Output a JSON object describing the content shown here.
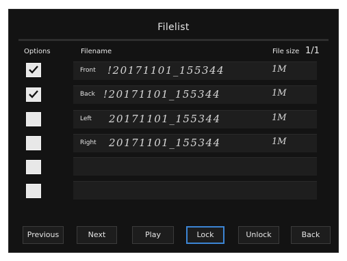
{
  "title": "Filelist",
  "headers": {
    "options": "Options",
    "filename": "Filename",
    "filesize": "File size",
    "page": "1/1"
  },
  "rows": [
    {
      "checked": true,
      "position": "Front",
      "filename": "!20171101_155344",
      "size": "1M"
    },
    {
      "checked": true,
      "position": "Back",
      "filename": "!20171101_155344",
      "size": "1M"
    },
    {
      "checked": false,
      "position": "Left",
      "filename": "20171101_155344",
      "size": "1M"
    },
    {
      "checked": false,
      "position": "Right",
      "filename": "20171101_155344",
      "size": "1M"
    },
    {
      "checked": false,
      "position": "",
      "filename": "",
      "size": ""
    },
    {
      "checked": false,
      "position": "",
      "filename": "",
      "size": ""
    }
  ],
  "buttons": {
    "previous": "Previous",
    "next": "Next",
    "play": "Play",
    "lock": "Lock",
    "unlock": "Unlock",
    "back": "Back"
  },
  "focused_button": "lock",
  "colors": {
    "background": "#131313",
    "checkbox": "#e8e8e8",
    "focus": "#3c86d6"
  }
}
